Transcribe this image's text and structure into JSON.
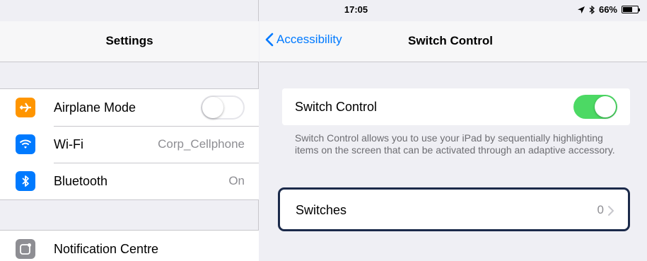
{
  "status_bar": {
    "device": "iPad",
    "time": "17:05",
    "battery": "66%",
    "battery_level": 0.66
  },
  "master": {
    "title": "Settings",
    "group1": [
      {
        "label": "Airplane Mode",
        "icon": "airplane-icon",
        "icon_color": "#ff9500",
        "toggle": false
      },
      {
        "label": "Wi-Fi",
        "detail": "Corp_Cellphone",
        "icon": "wifi-icon",
        "icon_color": "#007aff"
      },
      {
        "label": "Bluetooth",
        "detail": "On",
        "icon": "bluetooth-icon",
        "icon_color": "#007aff"
      }
    ],
    "group2": [
      {
        "label": "Notification Centre",
        "icon": "notification-centre-icon",
        "icon_color": "#8e8e93"
      }
    ]
  },
  "detail": {
    "back_label": "Accessibility",
    "title": "Switch Control",
    "switch_control_label": "Switch Control",
    "switch_control_enabled": true,
    "footer": "Switch Control allows you to use your iPad by sequentially highlighting items on the screen that can be activated through an adaptive accessory.",
    "switches_label": "Switches",
    "switches_value": "0"
  },
  "colors": {
    "accent": "#007aff",
    "toggle_on": "#4cd964",
    "highlight_border": "#1b2a4a"
  }
}
